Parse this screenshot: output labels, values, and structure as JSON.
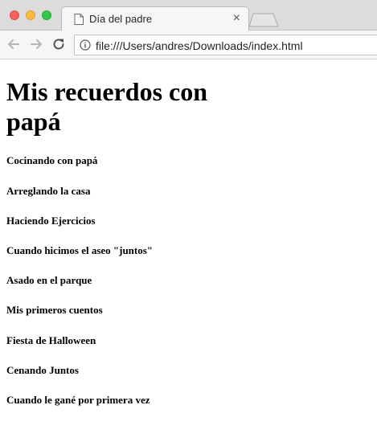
{
  "browser": {
    "tab": {
      "title": "Día del padre",
      "close_symbol": "×"
    },
    "address_bar": {
      "url": "file:///Users/andres/Downloads/index.html"
    }
  },
  "page": {
    "heading": "Mis recuerdos con papá",
    "memories": [
      "Cocinando con papá",
      "Arreglando la casa",
      "Haciendo Ejercicios",
      "Cuando hicimos el aseo \"juntos\"",
      "Asado en el parque",
      "Mis primeros cuentos",
      "Fiesta de Halloween",
      "Cenando Juntos",
      "Cuando le gané por primera vez"
    ]
  }
}
